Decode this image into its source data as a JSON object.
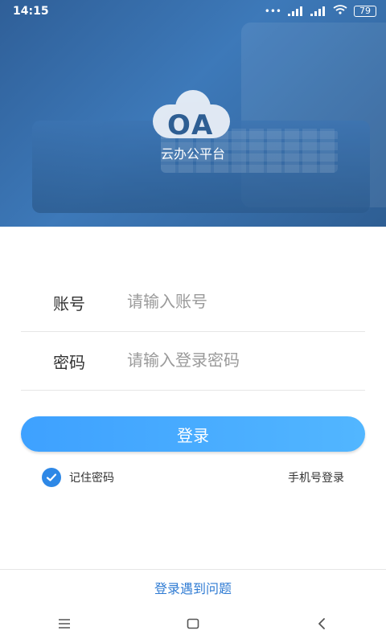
{
  "status_bar": {
    "time": "14:15",
    "dots": "•••",
    "battery": "79"
  },
  "logo": {
    "text": "OA",
    "subtitle": "云办公平台"
  },
  "form": {
    "account_label": "账号",
    "account_placeholder": "请输入账号",
    "password_label": "密码",
    "password_placeholder": "请输入登录密码"
  },
  "actions": {
    "login_button": "登录",
    "remember_label": "记住密码",
    "phone_login_label": "手机号登录",
    "problem_label": "登录遇到问题"
  },
  "colors": {
    "primary": "#3ea1ff",
    "link": "#2f7bd3",
    "checkbox": "#2e88e6"
  }
}
